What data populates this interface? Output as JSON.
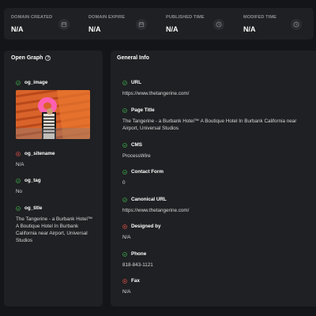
{
  "stats": [
    {
      "label": "DOMAIN CREATED",
      "value": "N/A",
      "icon": "calendar-icon"
    },
    {
      "label": "DOMAIN EXPIRE",
      "value": "N/A",
      "icon": "calendar-icon"
    },
    {
      "label": "PUBLISHED TIME",
      "value": "N/A",
      "icon": "clock-icon"
    },
    {
      "label": "MODIFED TIME",
      "value": "N/A",
      "icon": "clock-icon"
    }
  ],
  "open_graph": {
    "title": "Open Graph",
    "fields": [
      {
        "name": "og_image",
        "status": "ok",
        "value": ""
      },
      {
        "name": "og_sitename",
        "status": "error",
        "value": "N/A"
      },
      {
        "name": "og_tag",
        "status": "ok",
        "value": "No"
      },
      {
        "name": "og_title",
        "status": "ok",
        "value": "The Tangerine - a Burbank Hotel™ A Boutique Hotel In Burbank California near Airport, Universal Studios"
      }
    ]
  },
  "general_info": {
    "title": "General Info",
    "fields": [
      {
        "name": "URL",
        "status": "ok",
        "value": "https://www.thetangerine.com/"
      },
      {
        "name": "Page Title",
        "status": "ok",
        "value": "The Tangerine - a Burbank Hotel™ A Boutique Hotel In Burbank California near Airport, Universal Studios"
      },
      {
        "name": "CMS",
        "status": "ok",
        "value": "ProcessWire"
      },
      {
        "name": "Contact Form",
        "status": "ok",
        "value": "0"
      },
      {
        "name": "Canonical URL",
        "status": "ok",
        "value": "https://www.thetangerine.com/"
      },
      {
        "name": "Designed by",
        "status": "error",
        "value": "N/A"
      },
      {
        "name": "Phone",
        "status": "ok",
        "value": "818-843-1121"
      },
      {
        "name": "Fax",
        "status": "error",
        "value": "N/A"
      }
    ]
  },
  "colors": {
    "ok": "#3fb950",
    "error": "#e5534b",
    "panel": "#1f2023",
    "background": "#141518"
  }
}
